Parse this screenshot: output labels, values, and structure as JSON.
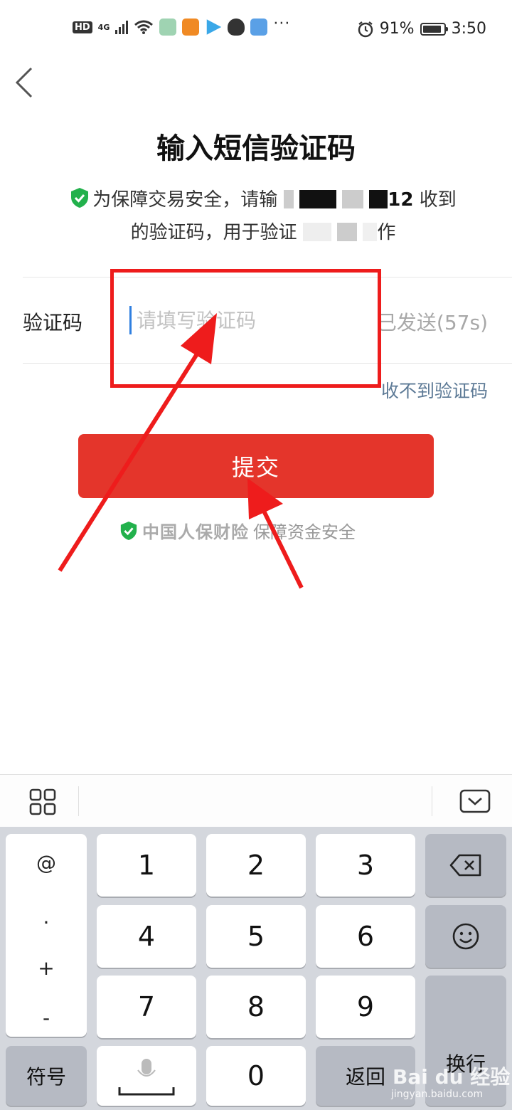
{
  "status_bar": {
    "hd": "HD",
    "network": "4G",
    "battery_percent": "91%",
    "time": "3:50"
  },
  "header": {
    "title": "输入短信验证码"
  },
  "notice": {
    "part1": "为保障交易安全，请输",
    "phone_tail": "12",
    "part2": "收到",
    "part3": "的验证码，用于验证",
    "part4": "作"
  },
  "form": {
    "label": "验证码",
    "placeholder": "请填写验证码",
    "resend": "已发送(57s)",
    "not_received": "收不到验证码"
  },
  "submit": {
    "label": "提交"
  },
  "insurance": {
    "brand": "中国人保财险",
    "text": "保障资金安全"
  },
  "keyboard": {
    "symbols": [
      "@",
      ".",
      "+",
      "-"
    ],
    "digits": [
      "1",
      "2",
      "3",
      "4",
      "5",
      "6",
      "7",
      "8",
      "9",
      "0"
    ],
    "symbol_key": "符号",
    "back_key": "返回",
    "enter_key": "换行"
  },
  "watermark": {
    "brand": "Bai du 经验",
    "url": "jingyan.baidu.com"
  },
  "colors": {
    "accent_red": "#e4352b",
    "annotation_red": "#ee1c1c",
    "shield_green": "#22b14c",
    "link_blue_grey": "#5d7a96",
    "caret_blue": "#2f7fe0"
  }
}
